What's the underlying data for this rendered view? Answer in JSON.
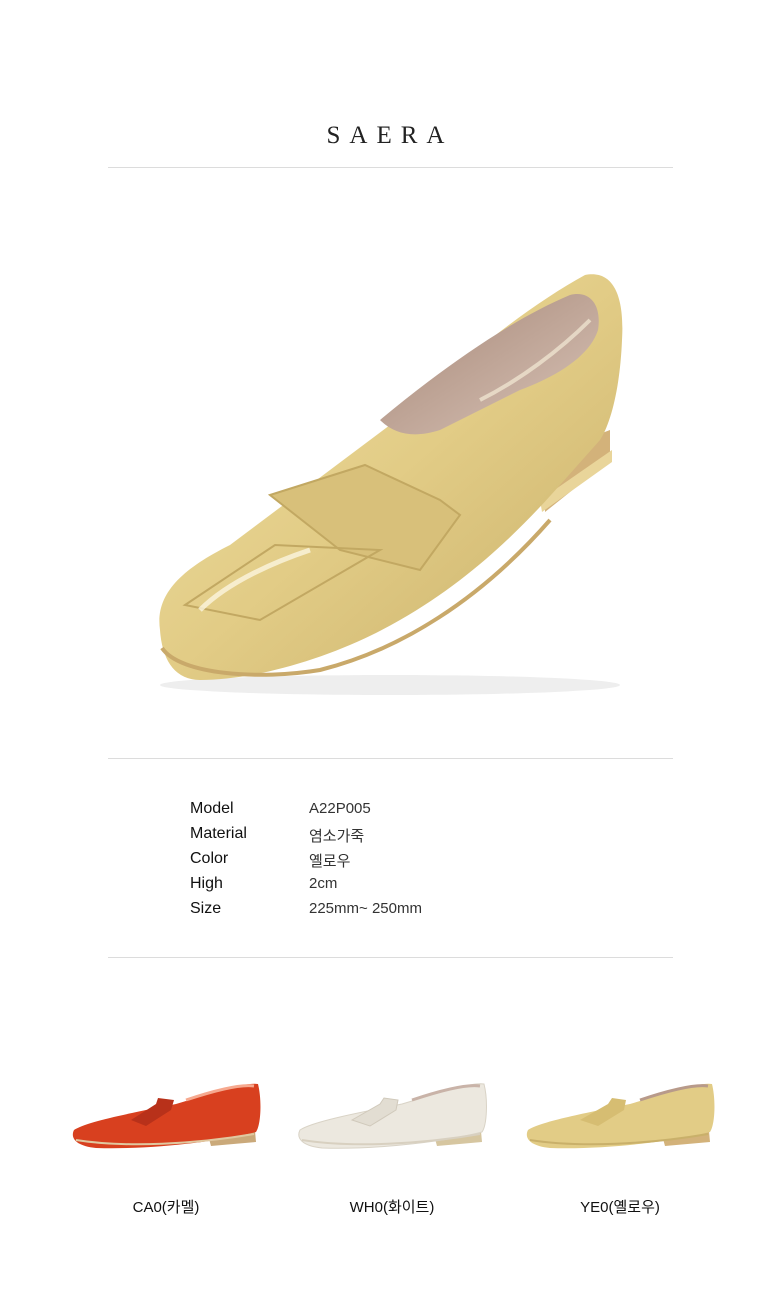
{
  "brand": "SAERA",
  "specs": [
    {
      "label": "Model",
      "value": "A22P005"
    },
    {
      "label": "Material",
      "value": "염소가죽"
    },
    {
      "label": "Color",
      "value": "옐로우"
    },
    {
      "label": "High",
      "value": "2cm"
    },
    {
      "label": "Size",
      "value": "225mm~ 250mm"
    }
  ],
  "variants": [
    {
      "caption": "CA0(카멜)",
      "color": "#d8401f"
    },
    {
      "caption": "WH0(화이트)",
      "color": "#ece8df"
    },
    {
      "caption": "YE0(옐로우)",
      "color": "#e2cc86"
    }
  ],
  "hero_color": "#e2cc86"
}
